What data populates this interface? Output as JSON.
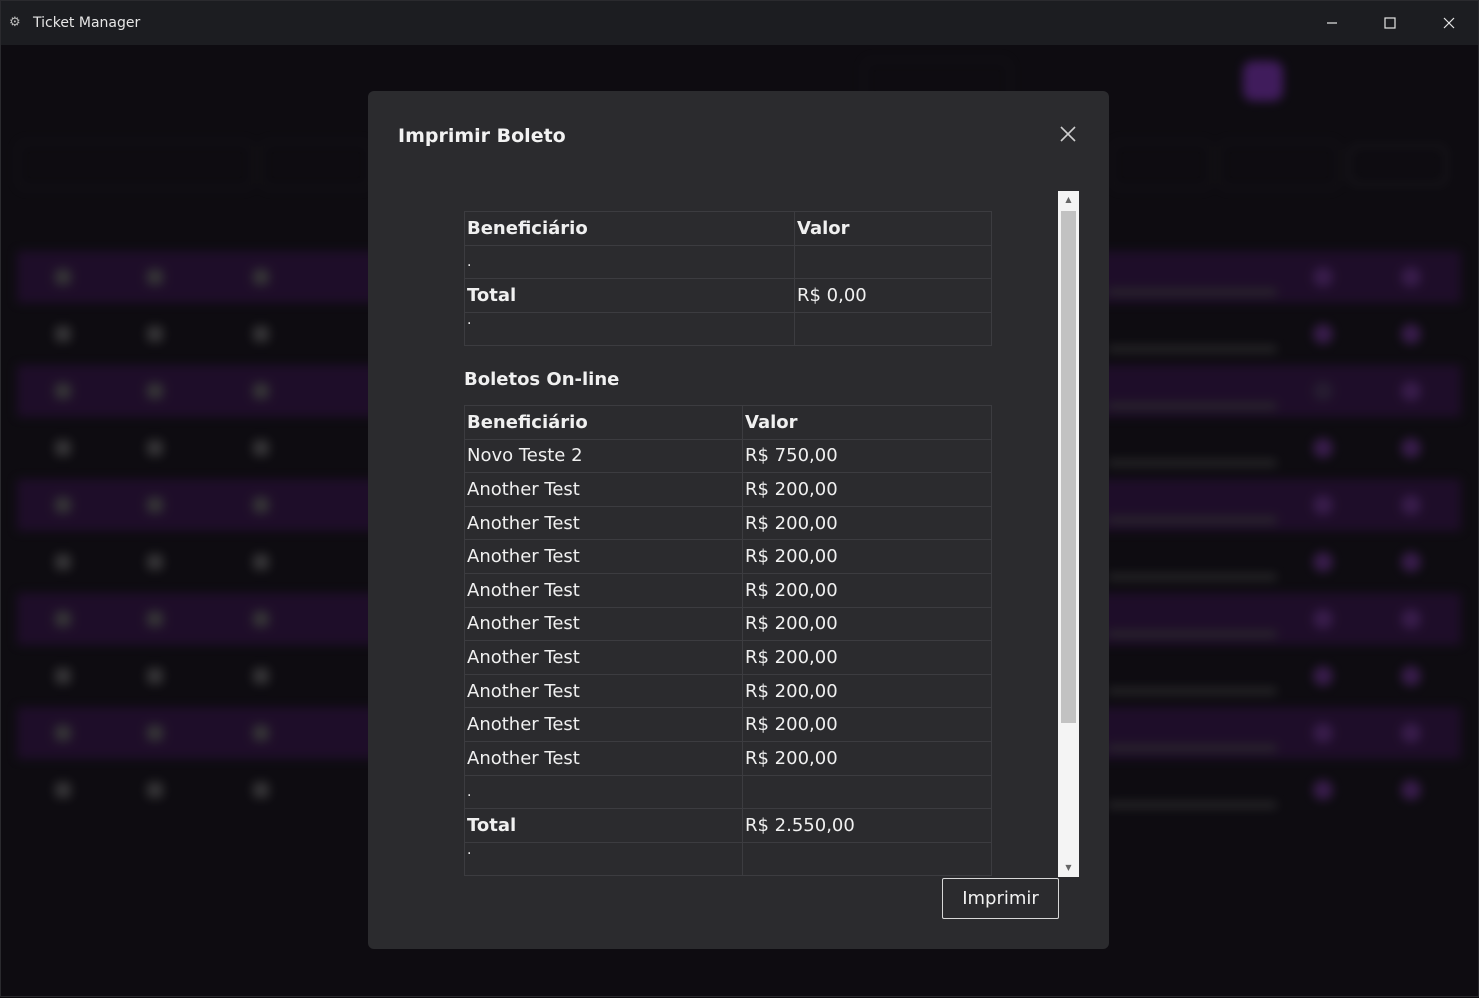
{
  "window": {
    "title": "Ticket Manager",
    "icon": "gear-icon"
  },
  "modal": {
    "title": "Imprimir Boleto",
    "print_label": "Imprimir",
    "summary_table": {
      "headers": [
        "Beneficiário",
        "Valor"
      ],
      "spacer": ".",
      "total_label": "Total",
      "total_value": "R$ 0,00",
      "trailing": "."
    },
    "online_section": {
      "heading": "Boletos On-line",
      "headers": [
        "Beneficiário",
        "Valor"
      ],
      "rows": [
        {
          "beneficiary": "Novo Teste 2",
          "value": "R$ 750,00"
        },
        {
          "beneficiary": "Another Test",
          "value": "R$ 200,00"
        },
        {
          "beneficiary": "Another Test",
          "value": "R$ 200,00"
        },
        {
          "beneficiary": "Another Test",
          "value": "R$ 200,00"
        },
        {
          "beneficiary": "Another Test",
          "value": "R$ 200,00"
        },
        {
          "beneficiary": "Another Test",
          "value": "R$ 200,00"
        },
        {
          "beneficiary": "Another Test",
          "value": "R$ 200,00"
        },
        {
          "beneficiary": "Another Test",
          "value": "R$ 200,00"
        },
        {
          "beneficiary": "Another Test",
          "value": "R$ 200,00"
        },
        {
          "beneficiary": "Another Test",
          "value": "R$ 200,00"
        }
      ],
      "spacer": ".",
      "total_label": "Total",
      "total_value": "R$ 2.550,00",
      "trailing": "."
    }
  },
  "colors": {
    "modal_bg": "#2b2b2e",
    "accent_purple": "#6a2a9a",
    "row_highlight": "#2c0f3d"
  }
}
